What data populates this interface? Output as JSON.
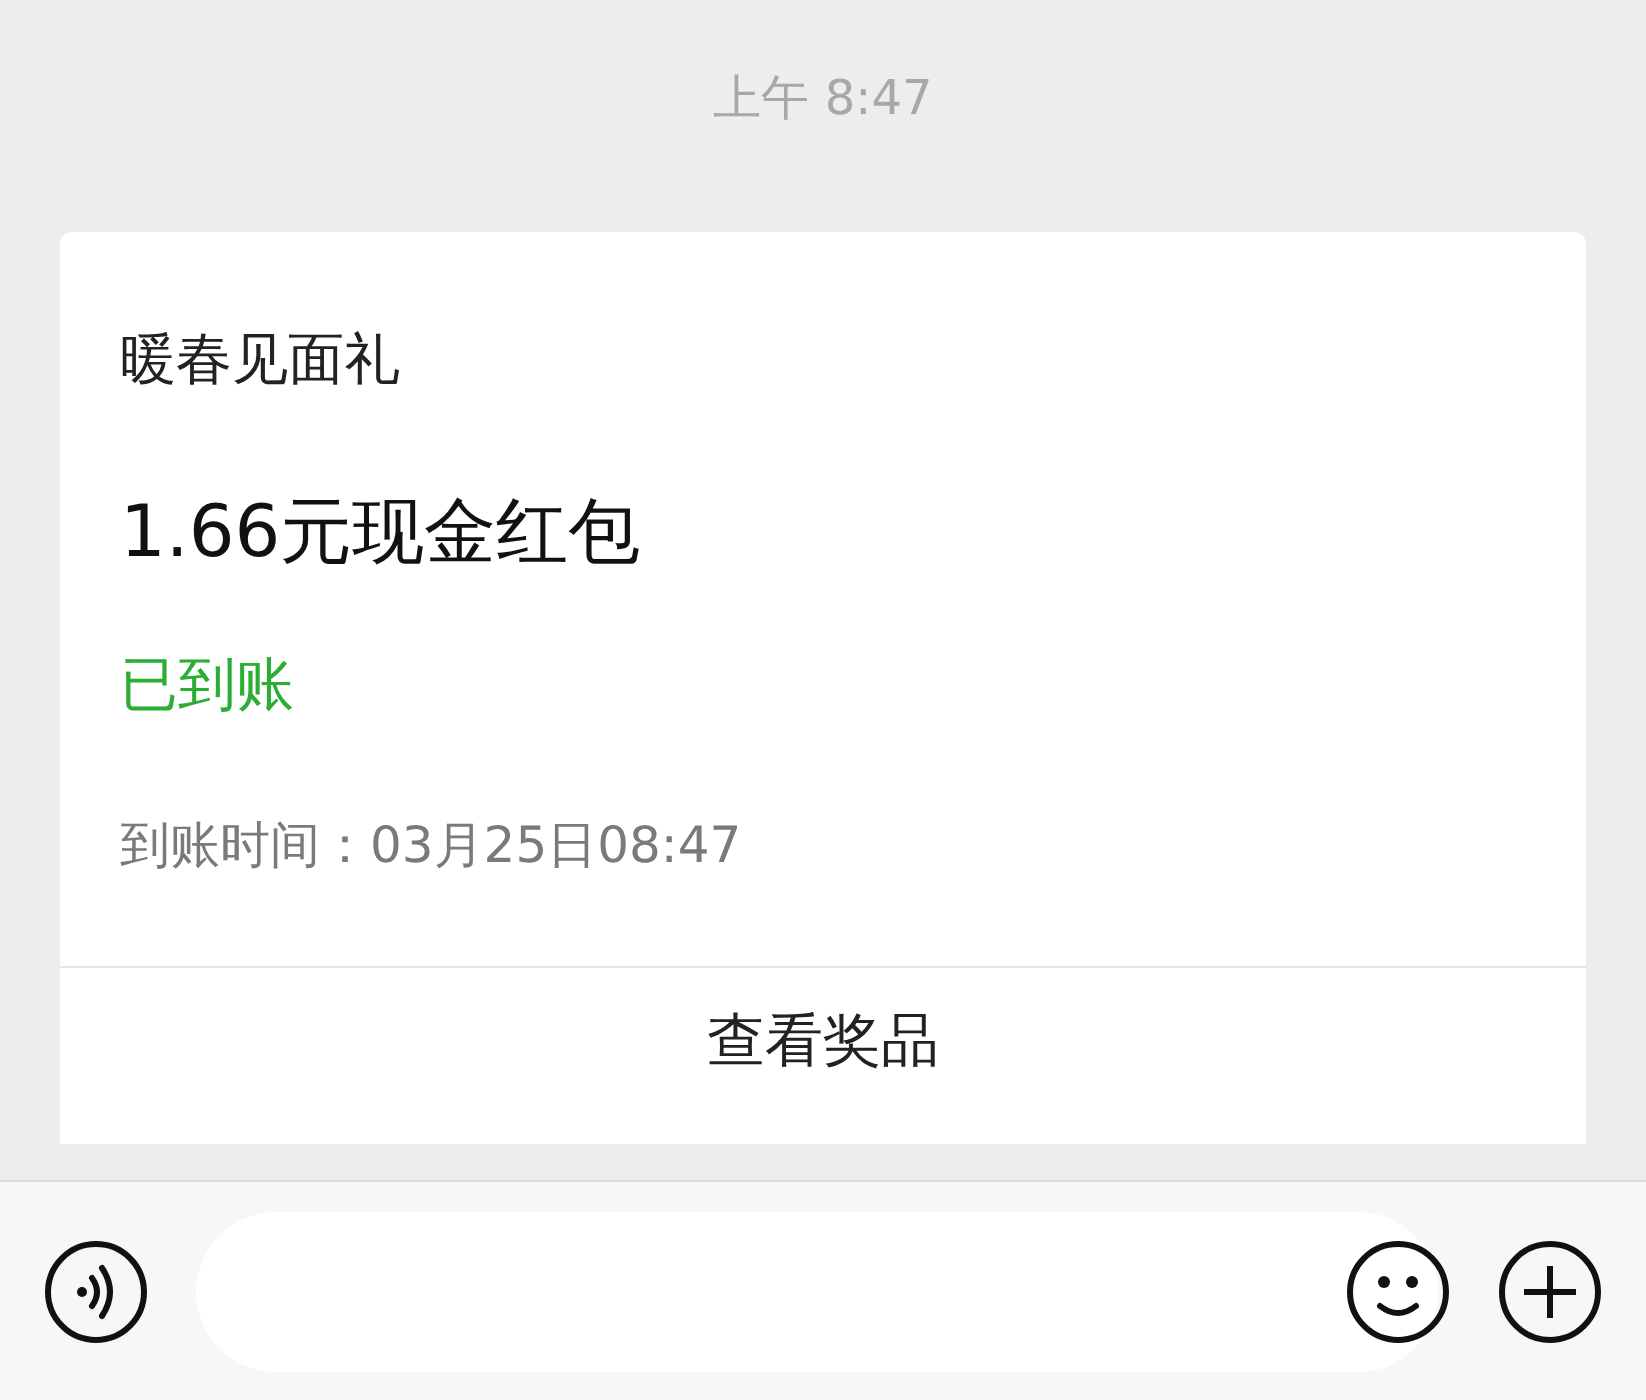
{
  "timestamp": "上午 8:47",
  "card": {
    "title": "暖春见面礼",
    "amount": "1.66元现金红包",
    "status": {
      "text": "已到账",
      "received": true
    },
    "arrival_time": "到账时间：03月25日08:47",
    "action": "查看奖品"
  }
}
